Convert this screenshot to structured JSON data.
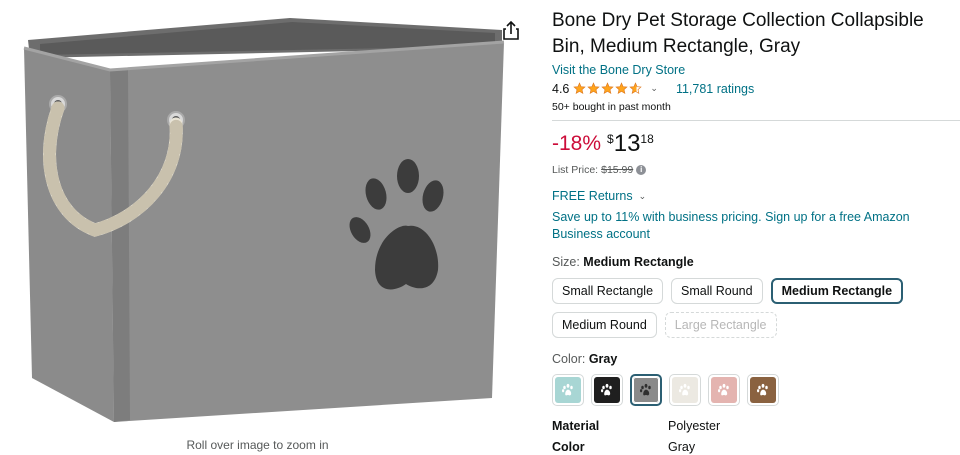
{
  "product": {
    "title": "Bone Dry Pet Storage Collection Collapsible Bin, Medium Rectangle, Gray",
    "store_link": "Visit the Bone Dry Store",
    "rating_value": "4.6",
    "rating_stars": 4.6,
    "ratings_count": "11,781 ratings",
    "bought_text": "50+ bought in past month"
  },
  "price": {
    "discount": "-18%",
    "currency": "$",
    "whole": "13",
    "fraction": "18",
    "list_label": "List Price:",
    "list_value": "$15.99"
  },
  "delivery": {
    "free_returns": "FREE Returns",
    "business": "Save up to 11% with business pricing. Sign up for a free Amazon Business account"
  },
  "size": {
    "label": "Size:",
    "selected": "Medium Rectangle",
    "options": [
      "Small Rectangle",
      "Small Round",
      "Medium Rectangle",
      "Medium Round",
      "Large Rectangle"
    ]
  },
  "color": {
    "label": "Color:",
    "selected": "Gray",
    "swatch_colors": [
      "#a8d6d4",
      "#1f1f1f",
      "#8a8a8a",
      "#ece9e2",
      "#e4b4b0",
      "#8a6240"
    ]
  },
  "specs": [
    {
      "key": "Material",
      "value": "Polyester"
    },
    {
      "key": "Color",
      "value": "Gray"
    }
  ],
  "image": {
    "zoom_hint": "Roll over image to zoom in"
  },
  "colors": {
    "link": "#007185",
    "discount": "#cc0c39",
    "star": "#ffa41c",
    "selected_border": "#2b5f73"
  },
  "icons": {
    "share": "share-icon",
    "info": "info-icon",
    "chevron": "chevron-down-icon",
    "paw": "paw-icon"
  }
}
